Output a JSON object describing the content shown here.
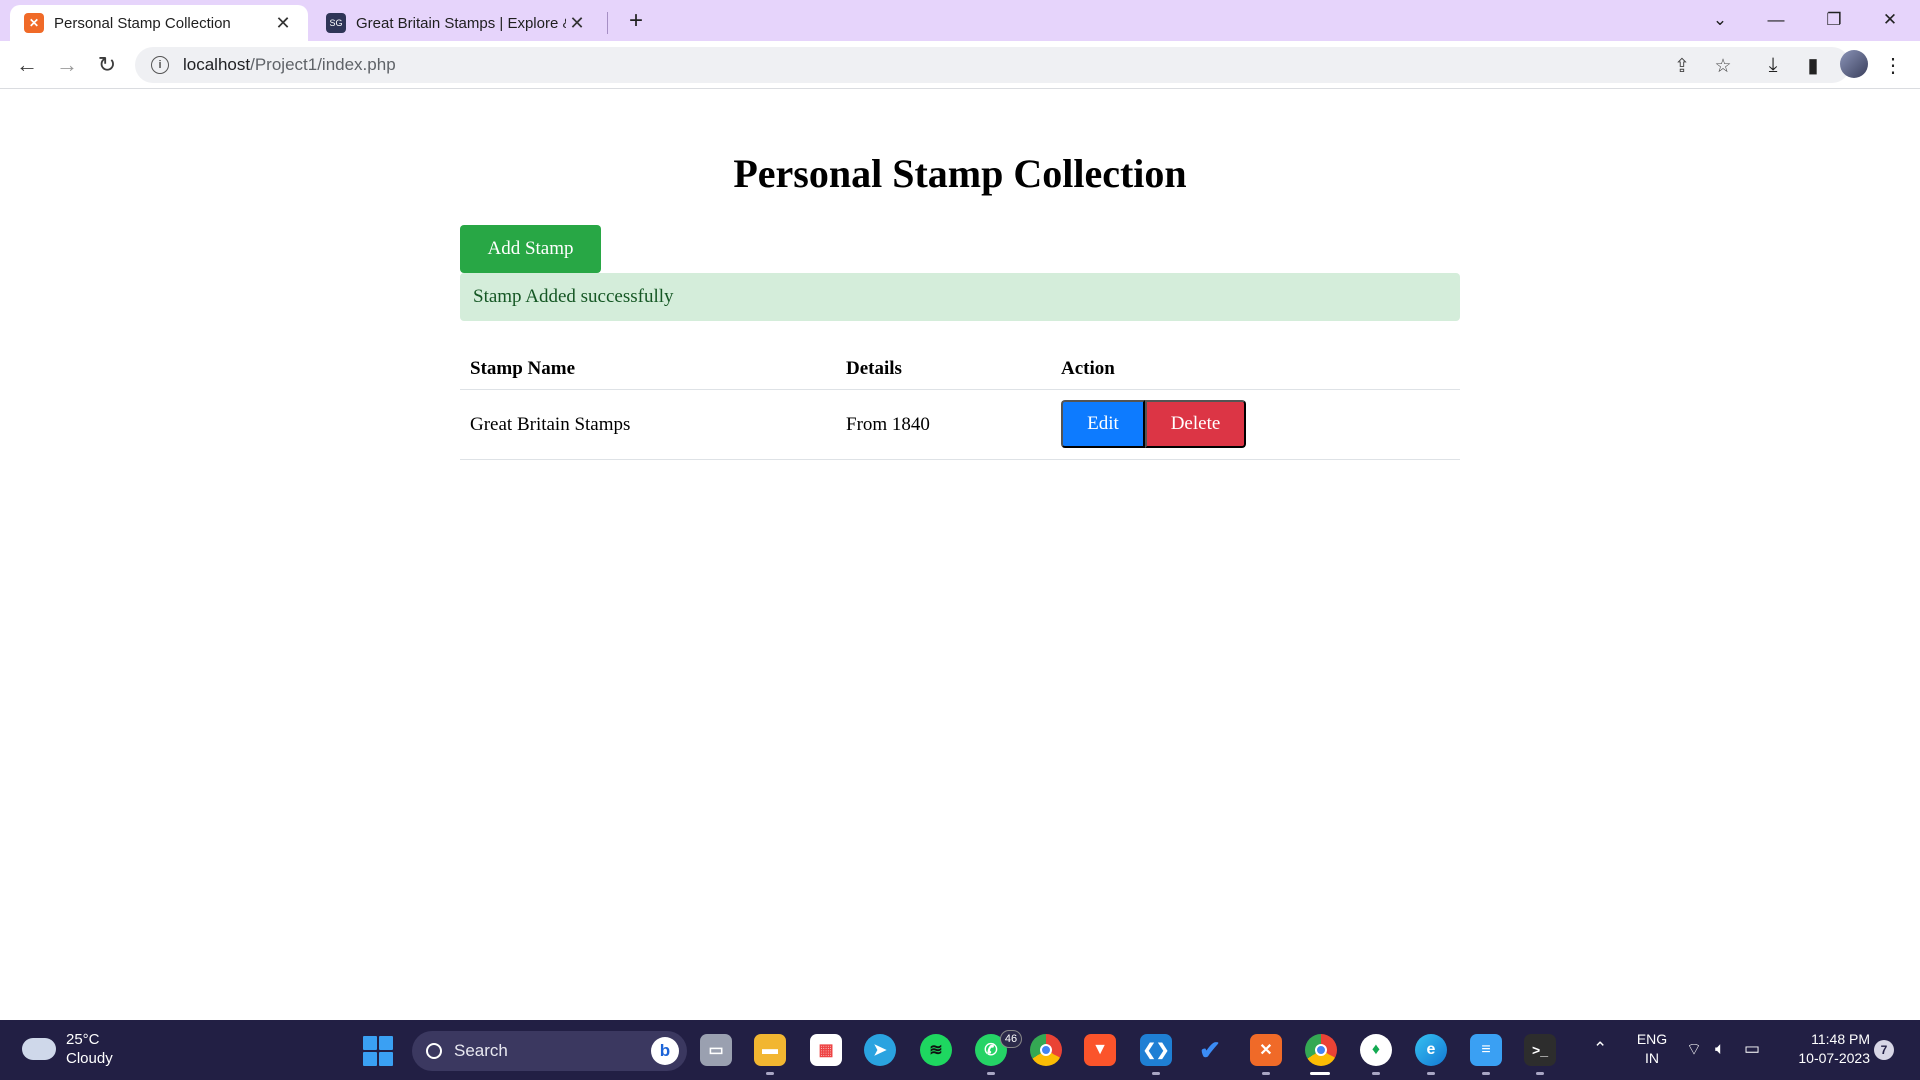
{
  "browser": {
    "tabs": [
      {
        "title": "Personal Stamp Collection",
        "favicon": "xampp-icon",
        "active": true
      },
      {
        "title": "Great Britain Stamps | Explore &",
        "favicon": "stamp-site-icon",
        "active": false
      }
    ],
    "url_host": "localhost",
    "url_path": "/Project1/index.php"
  },
  "page": {
    "title": "Personal Stamp Collection",
    "add_button": "Add Stamp",
    "alert": "Stamp Added successfully",
    "table": {
      "headers": [
        "Stamp Name",
        "Details",
        "Action"
      ],
      "rows": [
        {
          "name": "Great Britain Stamps",
          "details": "From 1840",
          "edit": "Edit",
          "delete": "Delete"
        }
      ]
    },
    "colors": {
      "add": "#28a745",
      "edit": "#0d7bff",
      "delete": "#dc3545",
      "alert_bg": "#d4edda"
    }
  },
  "taskbar": {
    "weather": {
      "temp": "25°C",
      "condition": "Cloudy"
    },
    "search_placeholder": "Search",
    "whatsapp_badge": "46",
    "language": {
      "line1": "ENG",
      "line2": "IN"
    },
    "time": "11:48 PM",
    "date": "10-07-2023",
    "notifications": "7"
  }
}
